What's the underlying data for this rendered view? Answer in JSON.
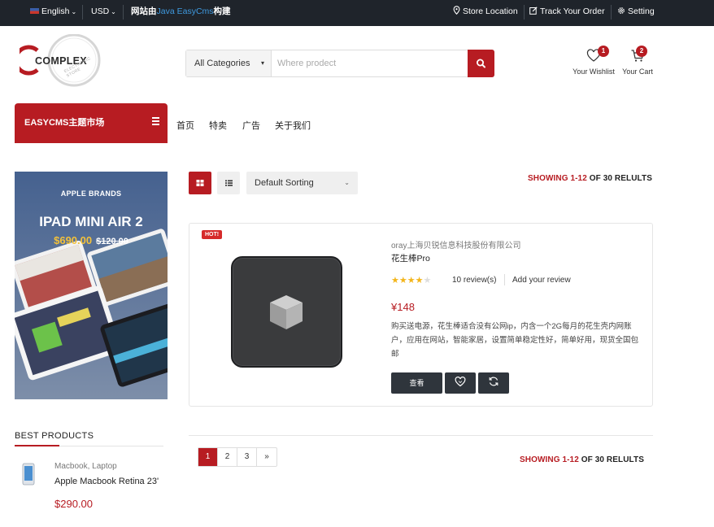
{
  "topbar": {
    "language": "English",
    "currency": "USD",
    "built_prefix": "网站由",
    "built_brand": "Java EasyCms",
    "built_suffix": "构建",
    "store_location": "Store Location",
    "track_order": "Track Your Order",
    "setting": "Setting"
  },
  "logo": {
    "text": "COMPLEX",
    "tagline": "ELECTRONIC STORE"
  },
  "search": {
    "category": "All Categories",
    "placeholder": "Where prodect"
  },
  "header": {
    "wishlist_label": "Your Wishlist",
    "wishlist_count": "1",
    "cart_label": "Your Cart",
    "cart_count": "2"
  },
  "nav": {
    "category_title": "EASYCMS主题市场",
    "links": [
      "首页",
      "特卖",
      "广告",
      "关于我们"
    ]
  },
  "promo": {
    "brand": "APPLE BRANDS",
    "title": "IPAD MINI AIR 2",
    "price": "$690.00",
    "old_price": "$120.00"
  },
  "best_products": {
    "title": "BEST PRODUCTS",
    "items": [
      {
        "category": "Macbook, Laptop",
        "name": "Apple Macbook Retina 23'",
        "price": "$290.00"
      }
    ]
  },
  "toolbar": {
    "sort": "Default Sorting",
    "showing_prefix": "SHOWING ",
    "showing_range": "1-12",
    "showing_suffix": " OF 30 RELULTS"
  },
  "product": {
    "badge": "HOT!",
    "vendor": "oray上海贝锐信息科技股份有限公司",
    "name": "花生棒Pro",
    "rating": 4,
    "reviews": "10 review(s)",
    "add_review": "Add your review",
    "price": "¥148",
    "description": "购买送电源，花生棒适合没有公网ip，内含一个2G每月的花生壳内网账户，应用在网站，智能家居，设置简单稳定性好，简单好用，现货全国包邮",
    "view_button": "查看"
  },
  "pagination": {
    "pages": [
      "1",
      "2",
      "3",
      "»"
    ],
    "active": "1"
  },
  "colors": {
    "accent": "#b71c22",
    "topbar": "#1f242b",
    "button_dark": "#2f353c",
    "star": "#f3b51b"
  }
}
